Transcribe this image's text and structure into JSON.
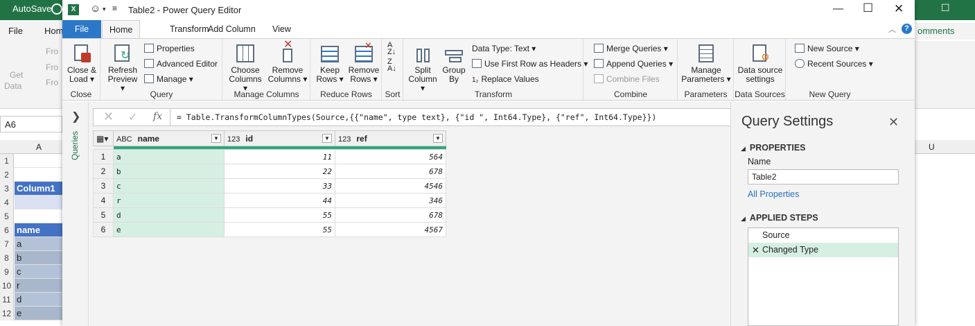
{
  "excel": {
    "autosave": "AutoSave",
    "menu": {
      "file": "File",
      "home": "Hom"
    },
    "comments": "omments",
    "ribbon": [
      "Get",
      "Data",
      "Fro",
      "Fro",
      "Fro"
    ],
    "namebox": "A6",
    "col_a": "A",
    "col_u": "U",
    "rows": [
      {
        "n": "1",
        "v": ""
      },
      {
        "n": "2",
        "v": ""
      },
      {
        "n": "3",
        "v": "Column1"
      },
      {
        "n": "4",
        "v": ""
      },
      {
        "n": "5",
        "v": ""
      },
      {
        "n": "6",
        "v": "name"
      },
      {
        "n": "7",
        "v": "a"
      },
      {
        "n": "8",
        "v": "b"
      },
      {
        "n": "9",
        "v": "c"
      },
      {
        "n": "10",
        "v": "r"
      },
      {
        "n": "11",
        "v": "d"
      },
      {
        "n": "12",
        "v": "e"
      }
    ]
  },
  "window": {
    "title": "Table2 - Power Query Editor"
  },
  "tabs": {
    "file": "File",
    "home": "Home",
    "transform": "Transform",
    "add_column": "Add Column",
    "view": "View"
  },
  "ribbon": {
    "close": {
      "close_load_1": "Close &",
      "close_load_2": "Load",
      "label": "Close"
    },
    "query": {
      "refresh_1": "Refresh",
      "refresh_2": "Preview",
      "properties": "Properties",
      "advanced_editor": "Advanced Editor",
      "manage": "Manage",
      "label": "Query"
    },
    "manage_columns": {
      "choose_1": "Choose",
      "choose_2": "Columns",
      "remove_1": "Remove",
      "remove_2": "Columns",
      "label": "Manage Columns"
    },
    "reduce_rows": {
      "keep_1": "Keep",
      "keep_2": "Rows",
      "remove_1": "Remove",
      "remove_2": "Rows",
      "label": "Reduce Rows"
    },
    "sort": {
      "label": "Sort"
    },
    "transform": {
      "split_1": "Split",
      "split_2": "Column",
      "group_1": "Group",
      "group_2": "By",
      "data_type": "Data Type: Text",
      "first_row": "Use First Row as Headers",
      "replace": "Replace Values",
      "label": "Transform"
    },
    "combine": {
      "merge": "Merge Queries",
      "append": "Append Queries",
      "combine_files": "Combine Files",
      "label": "Combine"
    },
    "parameters": {
      "manage_1": "Manage",
      "manage_2": "Parameters",
      "label": "Parameters"
    },
    "data_sources": {
      "ds_1": "Data source",
      "ds_2": "settings",
      "label": "Data Sources"
    },
    "new_query": {
      "new_source": "New Source",
      "recent_sources": "Recent Sources",
      "label": "New Query"
    }
  },
  "queries_label": "Queries",
  "formula": "= Table.TransformColumnTypes(Source,{{\"name\", type text}, {\"id \", Int64.Type}, {\"ref\", Int64.Type}})",
  "table": {
    "columns": [
      {
        "type": "ABC",
        "name": "name"
      },
      {
        "type": "123",
        "name": "id"
      },
      {
        "type": "123",
        "name": "ref"
      }
    ],
    "rows": [
      {
        "n": "1",
        "name": "a",
        "id": "11",
        "ref": "564"
      },
      {
        "n": "2",
        "name": "b",
        "id": "22",
        "ref": "678"
      },
      {
        "n": "3",
        "name": "c",
        "id": "33",
        "ref": "4546"
      },
      {
        "n": "4",
        "name": "r",
        "id": "44",
        "ref": "346"
      },
      {
        "n": "5",
        "name": "d",
        "id": "55",
        "ref": "678"
      },
      {
        "n": "6",
        "name": "e",
        "id": "55",
        "ref": "4567"
      }
    ]
  },
  "settings": {
    "title": "Query Settings",
    "properties": "PROPERTIES",
    "name_label": "Name",
    "name_value": "Table2",
    "all_properties": "All Properties",
    "applied_steps": "APPLIED STEPS",
    "steps": [
      "Source",
      "Changed Type"
    ]
  },
  "colors": {
    "excel_green": "#217346",
    "file_tab": "#2b78c8",
    "selected": "#d6efe3",
    "quality_bar": "#2ea77e"
  }
}
